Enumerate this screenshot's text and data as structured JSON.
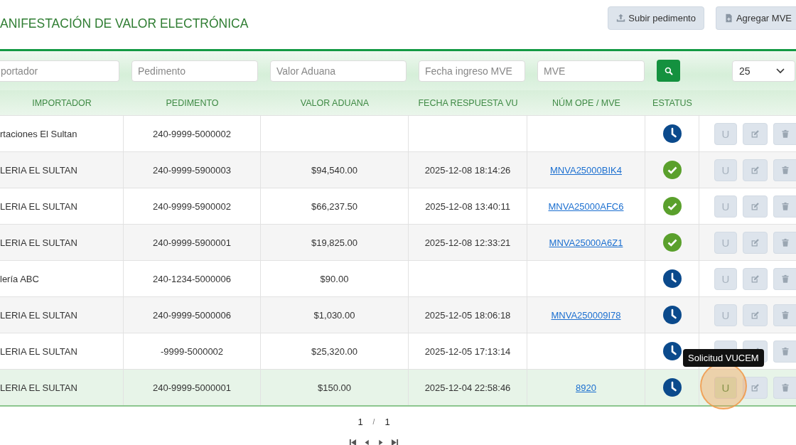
{
  "header": {
    "title": "ANIFESTACIÓN DE VALOR ELECTRÓNICA",
    "buttons": [
      {
        "kind": "upload",
        "label": "Subir pedimento"
      },
      {
        "kind": "add",
        "label": "Agregar MVE"
      }
    ]
  },
  "filters": {
    "fields": [
      {
        "placeholder": "portador"
      },
      {
        "placeholder": "Pedimento"
      },
      {
        "placeholder": "Valor Aduana"
      },
      {
        "placeholder": "Fecha ingreso MVE"
      },
      {
        "placeholder": "MVE"
      }
    ],
    "page_size": "25"
  },
  "table": {
    "columns": [
      "IMPORTADOR",
      "PEDIMENTO",
      "VALOR ADUANA",
      "FECHA RESPUESTA VU",
      "NÚM OPE / MVE",
      "ESTATUS"
    ],
    "rows": [
      {
        "importador": "rtaciones El Sultan",
        "pedimento": "240-9999-5000002",
        "valor_aduana": "",
        "fecha_respuesta_vu": "",
        "num_ope_mve": "",
        "status": {
          "kind": "pending"
        },
        "vucem_label": "U",
        "selected": false
      },
      {
        "importador": "LERIA EL SULTAN",
        "pedimento": "240-9999-5900003",
        "valor_aduana": "$94,540.00",
        "fecha_respuesta_vu": "2025-12-08 18:14:26",
        "num_ope_mve": "MNVA25000BIK4",
        "status": {
          "kind": "done"
        },
        "vucem_label": "U",
        "selected": false
      },
      {
        "importador": "LERIA EL SULTAN",
        "pedimento": "240-9999-5900002",
        "valor_aduana": "$66,237.50",
        "fecha_respuesta_vu": "2025-12-08 13:40:11",
        "num_ope_mve": "MNVA25000AFC6",
        "status": {
          "kind": "done"
        },
        "vucem_label": "U",
        "selected": false
      },
      {
        "importador": "LERIA EL SULTAN",
        "pedimento": "240-9999-5900001",
        "valor_aduana": "$19,825.00",
        "fecha_respuesta_vu": "2025-12-08 12:33:21",
        "num_ope_mve": "MNVA25000A6Z1",
        "status": {
          "kind": "done"
        },
        "vucem_label": "U",
        "selected": false
      },
      {
        "importador": "lería ABC",
        "pedimento": "240-1234-5000006",
        "valor_aduana": "$90.00",
        "fecha_respuesta_vu": "",
        "num_ope_mve": "",
        "status": {
          "kind": "pending"
        },
        "vucem_label": "U",
        "selected": false
      },
      {
        "importador": "LERIA EL SULTAN",
        "pedimento": "240-9999-5000006",
        "valor_aduana": "$1,030.00",
        "fecha_respuesta_vu": "2025-12-05 18:06:18",
        "num_ope_mve": "MNVA250009I78",
        "status": {
          "kind": "pending"
        },
        "vucem_label": "U",
        "selected": false
      },
      {
        "importador": "LERIA EL SULTAN",
        "pedimento": "-9999-5000002",
        "valor_aduana": "$25,320.00",
        "fecha_respuesta_vu": "2025-12-05 17:13:14",
        "num_ope_mve": "",
        "status": {
          "kind": "pending"
        },
        "selected": false
      },
      {
        "importador": "LERIA EL SULTAN",
        "pedimento": "240-9999-5000001",
        "valor_aduana": "$150.00",
        "fecha_respuesta_vu": "2025-12-04 22:58:46",
        "num_ope_mve": "8920",
        "status": {
          "kind": "pending"
        },
        "vucem_label": "U",
        "selected": true
      }
    ]
  },
  "tooltip": {
    "text": "Solicitud VUCEM"
  },
  "click_marker": true,
  "pagination": {
    "current": "1",
    "separator": "/",
    "total": "1"
  }
}
